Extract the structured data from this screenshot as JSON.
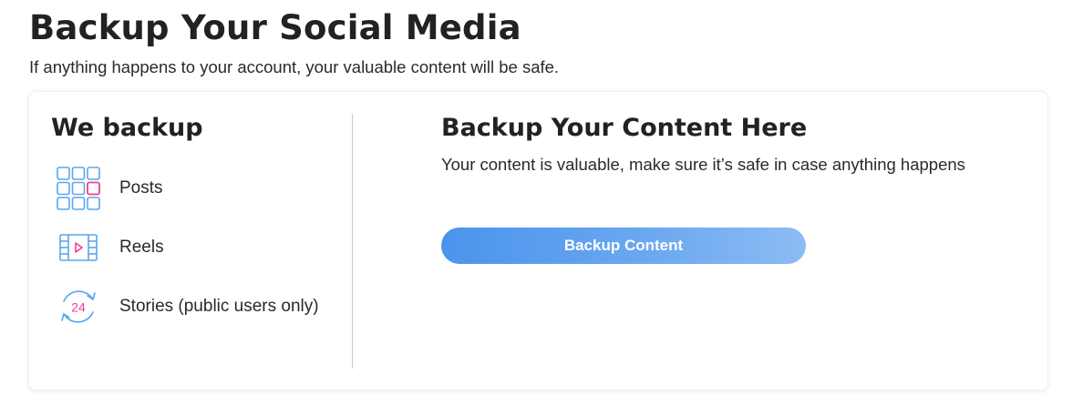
{
  "header": {
    "title": "Backup Your Social Media",
    "subtitle": "If anything happens to your account, your valuable content will be safe."
  },
  "left": {
    "title": "We backup",
    "items": [
      {
        "label": "Posts",
        "icon": "posts-grid-icon"
      },
      {
        "label": "Reels",
        "icon": "reels-film-icon"
      },
      {
        "label": "Stories (public users only)",
        "icon": "stories-24-icon",
        "icon_text": "24"
      }
    ]
  },
  "right": {
    "title": "Backup Your Content Here",
    "description": "Your content is valuable, make sure it’s safe in case anything happens",
    "button_label": "Backup Content"
  },
  "colors": {
    "icon_blue": "#5aa6ec",
    "icon_pink": "#ef3e8c",
    "button_start": "#4a94ec",
    "button_end": "#8cbcf4"
  }
}
